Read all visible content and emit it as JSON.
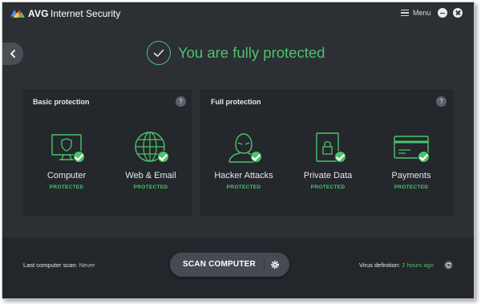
{
  "app": {
    "brand": "AVG",
    "title": "Internet Security",
    "menu_label": "Menu"
  },
  "status": {
    "headline": "You are fully protected"
  },
  "panels": {
    "basic": {
      "title": "Basic protection",
      "help": "?",
      "features": [
        {
          "label": "Computer",
          "status": "PROTECTED",
          "icon": "monitor-shield-icon"
        },
        {
          "label": "Web & Email",
          "status": "PROTECTED",
          "icon": "globe-icon"
        }
      ]
    },
    "full": {
      "title": "Full protection",
      "help": "?",
      "features": [
        {
          "label": "Hacker Attacks",
          "status": "PROTECTED",
          "icon": "hacker-icon"
        },
        {
          "label": "Private Data",
          "status": "PROTECTED",
          "icon": "lock-document-icon"
        },
        {
          "label": "Payments",
          "status": "PROTECTED",
          "icon": "credit-card-icon"
        }
      ]
    }
  },
  "footer": {
    "last_scan_label": "Last computer scan:",
    "last_scan_value": "Never",
    "scan_button": "SCAN COMPUTER",
    "virus_label": "Virus definition:",
    "virus_value": "2 hours ago"
  },
  "colors": {
    "accent_green": "#4cc46a",
    "background": "#2c2f34",
    "panel": "#24272c"
  }
}
